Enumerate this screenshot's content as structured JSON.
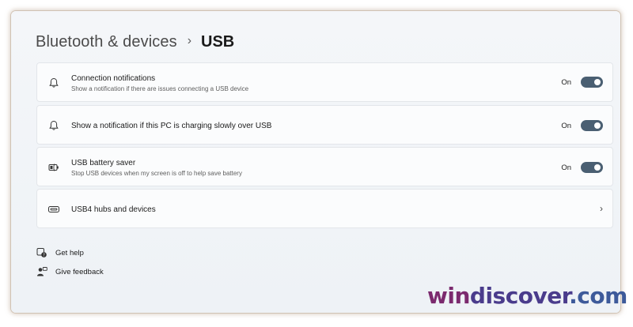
{
  "breadcrumb": {
    "parent": "Bluetooth & devices",
    "separator": "›",
    "current": "USB"
  },
  "cards": [
    {
      "title": "Connection notifications",
      "description": "Show a notification if there are issues connecting a USB device",
      "toggle_label": "On",
      "toggle_state": "on",
      "icon": "bell-icon"
    },
    {
      "title": "Show a notification if this PC is charging slowly over USB",
      "description": "",
      "toggle_label": "On",
      "toggle_state": "on",
      "icon": "bell-icon"
    },
    {
      "title": "USB battery saver",
      "description": "Stop USB devices when my screen is off to help save battery",
      "toggle_label": "On",
      "toggle_state": "on",
      "icon": "battery-saver-icon"
    },
    {
      "title": "USB4 hubs and devices",
      "description": "",
      "icon": "usb4-icon",
      "chevron": "›"
    }
  ],
  "links": {
    "help": "Get help",
    "feedback": "Give feedback"
  },
  "watermark": {
    "part1": "win",
    "part2": "discover",
    "part3": ".com"
  },
  "colors": {
    "toggle_on": "#4a5f72",
    "card_bg": "#fbfcfd",
    "page_bg": "#f2f5f8"
  }
}
